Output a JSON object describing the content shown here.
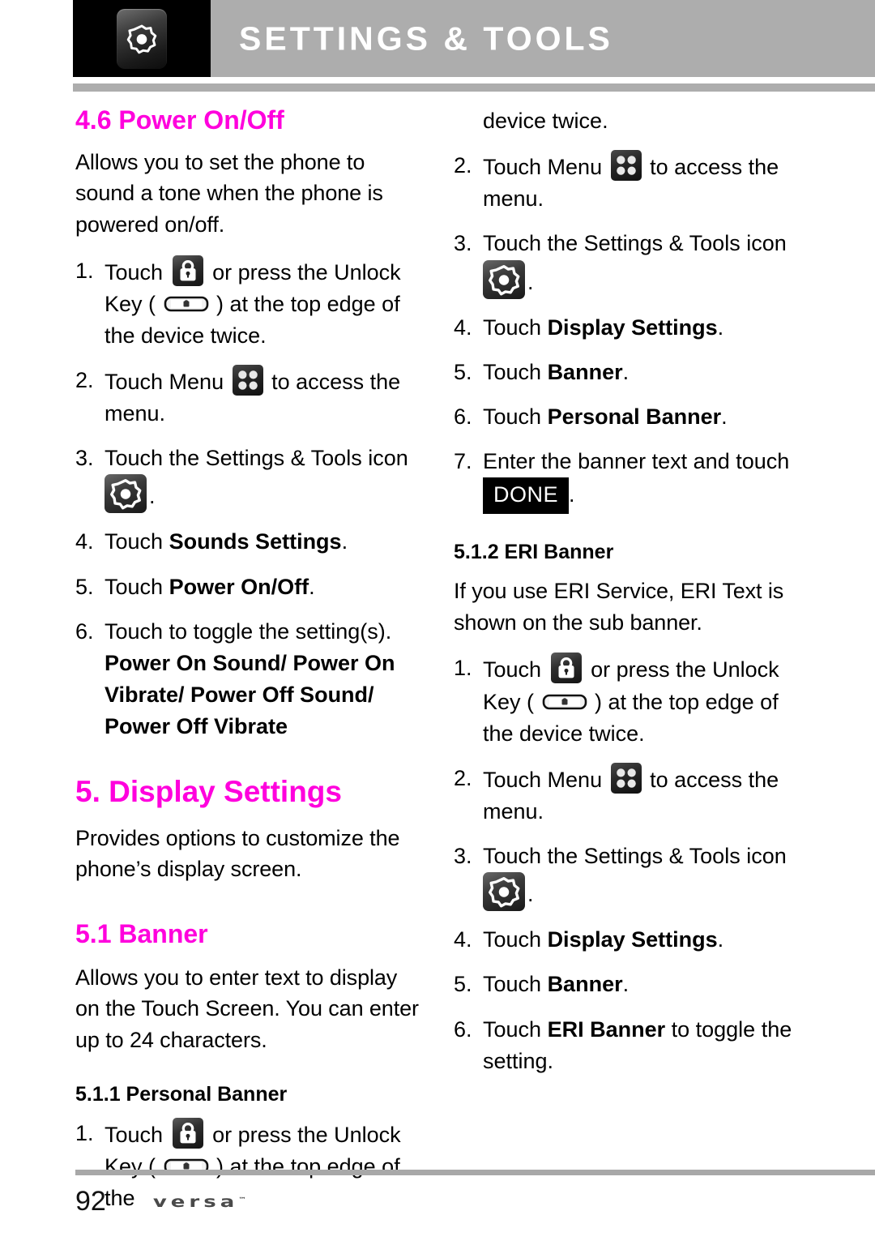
{
  "header": {
    "title": "SETTINGS & TOOLS",
    "icon": "gear-icon"
  },
  "left_column": {
    "section_46_heading": "4.6 Power On/Off",
    "section_46_intro": "Allows you to set the phone to sound a tone when the phone is powered on/off.",
    "steps": [
      {
        "num": "1.",
        "pre": "Touch ",
        "icon": "lock-icon",
        "mid": " or press the Unlock Key ( ",
        "key_icon": "unlock-key-icon",
        "post": " ) at the top edge of the device twice."
      },
      {
        "num": "2.",
        "pre": "Touch Menu ",
        "icon": "menu-icon",
        "post": " to access the menu."
      },
      {
        "num": "3.",
        "pre": "Touch the Settings & Tools icon ",
        "icon": "gear-icon",
        "post": "."
      },
      {
        "num": "4.",
        "pre": "Touch ",
        "bold": "Sounds Settings",
        "post": "."
      },
      {
        "num": "5.",
        "pre": "Touch ",
        "bold": "Power On/Off",
        "post": "."
      },
      {
        "num": "6.",
        "pre": "Touch to toggle the setting(s).",
        "bold": "Power On Sound/ Power On Vibrate/ Power Off Sound/ Power Off Vibrate",
        "post": ""
      }
    ],
    "section_5_heading": "5. Display Settings",
    "section_5_intro": "Provides options to customize the phone’s display screen.",
    "section_51_heading": "5.1 Banner",
    "section_51_intro": "Allows you to enter text to display on the Touch Screen. You can enter up to 24 characters.",
    "section_511_heading": "5.1.1 Personal Banner",
    "step_511_1": {
      "num": "1.",
      "pre": "Touch ",
      "icon": "lock-icon",
      "mid": " or press the Unlock Key ( ",
      "key_icon": "unlock-key-icon",
      "post": " ) at the top edge of the"
    }
  },
  "right_column": {
    "continuation": "device twice.",
    "steps_personal": [
      {
        "num": "2.",
        "pre": "Touch Menu ",
        "icon": "menu-icon",
        "post": " to access the menu."
      },
      {
        "num": "3.",
        "pre": "Touch the Settings & Tools icon ",
        "icon": "gear-icon",
        "post": "."
      },
      {
        "num": "4.",
        "pre": "Touch ",
        "bold": "Display Settings",
        "post": "."
      },
      {
        "num": "5.",
        "pre": "Touch ",
        "bold": "Banner",
        "post": "."
      },
      {
        "num": "6.",
        "pre": "Touch ",
        "bold": "Personal Banner",
        "post": "."
      },
      {
        "num": "7.",
        "pre": "Enter the banner text and touch ",
        "button": "DONE",
        "post": "."
      }
    ],
    "section_512_heading": "5.1.2 ERI Banner",
    "section_512_intro": "If you use ERI Service, ERI Text is shown on the sub banner.",
    "steps_eri": [
      {
        "num": "1.",
        "pre": "Touch ",
        "icon": "lock-icon",
        "mid": " or press the Unlock Key ( ",
        "key_icon": "unlock-key-icon",
        "post": " ) at the top edge of the device twice."
      },
      {
        "num": "2.",
        "pre": "Touch Menu ",
        "icon": "menu-icon",
        "post": " to access the menu."
      },
      {
        "num": "3.",
        "pre": "Touch the Settings & Tools icon ",
        "icon": "gear-icon",
        "post": "."
      },
      {
        "num": "4.",
        "pre": "Touch ",
        "bold": "Display Settings",
        "post": "."
      },
      {
        "num": "5.",
        "pre": "Touch ",
        "bold": "Banner",
        "post": "."
      },
      {
        "num": "6.",
        "pre": "Touch ",
        "bold": "ERI Banner",
        "post": " to toggle the setting."
      }
    ]
  },
  "footer": {
    "page_number": "92",
    "brand": "versa",
    "trademark": "™"
  },
  "colors": {
    "heading_magenta": "#ff00dd",
    "header_bar_gray": "#adadad",
    "rule_gray": "#a8a8a8",
    "text_black": "#000000"
  }
}
